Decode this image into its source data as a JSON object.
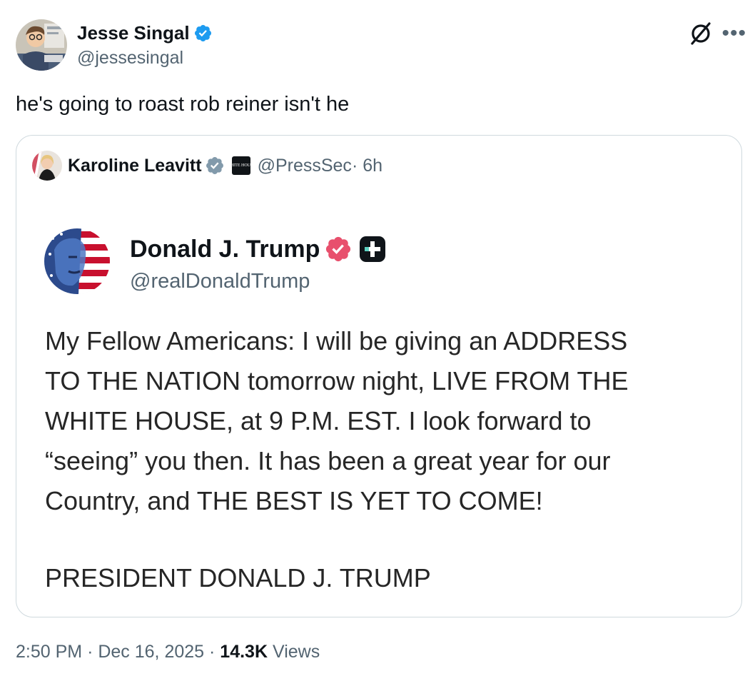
{
  "tweet": {
    "author_name": "Jesse Singal",
    "author_handle": "@jessesingal",
    "text": "he's going to roast rob reiner isn't he",
    "time": "2:50 PM",
    "date": "Dec 16, 2025",
    "views_count": "14.3K",
    "views_label": "Views",
    "separator": "·",
    "more_icon": "more-horizontal-icon",
    "grok_icon": "grok-icon"
  },
  "quote": {
    "author_name": "Karoline Leavitt",
    "affiliate_label": "WHITE HOUSE",
    "author_handle": "@PressSec",
    "age": "· 6h"
  },
  "embedded_post": {
    "author_name": "Donald J. Trump",
    "author_handle": "@realDonaldTrump",
    "body_lines": [
      "My Fellow Americans: I will be giving an ADDRESS",
      "TO THE NATION tomorrow night, LIVE FROM THE",
      "WHITE HOUSE, at 9 P.M. EST. I look forward to",
      "“seeing” you then. It has been a great year for our",
      "Country, and THE BEST IS YET TO COME!"
    ],
    "signature": "PRESIDENT DONALD J. TRUMP"
  },
  "colors": {
    "verified_blue": "#1d9bf0",
    "verified_gray": "#829aab",
    "truth_badge_pink": "#e8506d",
    "secondary_text": "#536471",
    "border": "#cfd9de"
  }
}
